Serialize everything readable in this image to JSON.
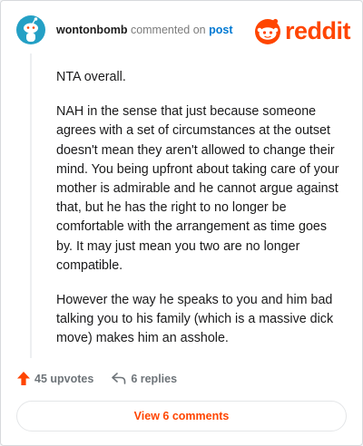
{
  "header": {
    "username": "wontonbomb",
    "action_text": "commented on",
    "post_link": "post"
  },
  "logo": {
    "icon": "reddit-alien-icon",
    "wordmark": "reddit",
    "color": "#ff4500"
  },
  "comment": {
    "paragraphs": [
      "NTA overall.",
      "NAH in the sense that just because someone agrees with a set of circumstances at the outset doesn't mean they aren't allowed to change their mind. You being upfront about taking care of your mother is admirable and he cannot argue against that, but he has the right to no longer be comfortable with the arrangement as time goes by. It may just mean you two are no longer compatible.",
      "However the way he speaks to you and him bad talking you to his family (which is a massive dick move) makes him an asshole."
    ]
  },
  "actions": {
    "upvotes_label": "45 upvotes",
    "upvote_icon": "upvote-arrow-icon",
    "replies_label": "6 replies",
    "reply_icon": "reply-arrow-icon"
  },
  "view_comments_label": "View 6 comments"
}
